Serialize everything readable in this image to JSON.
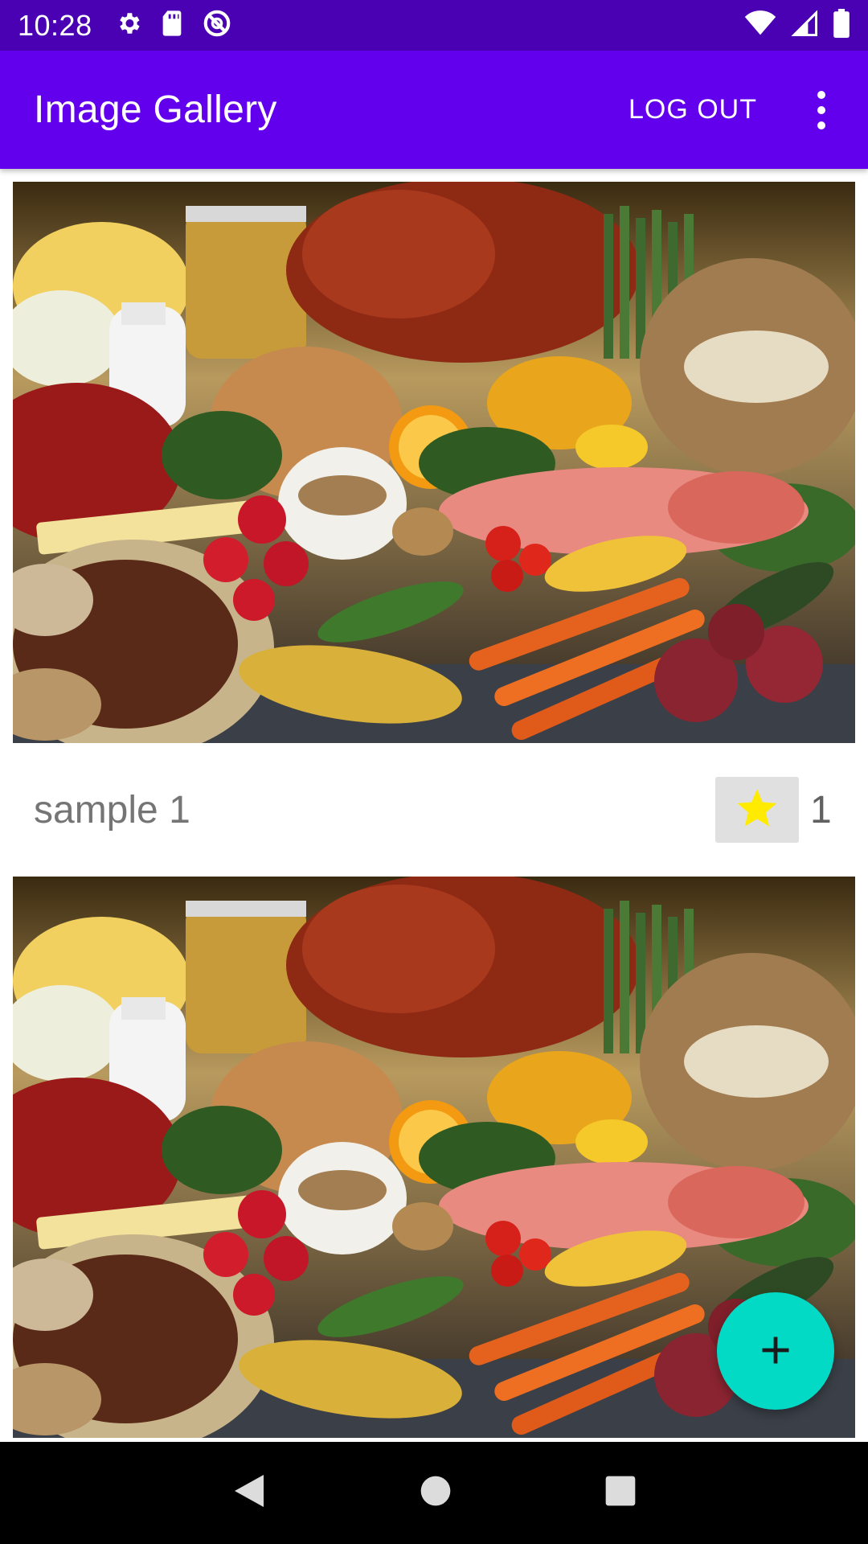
{
  "status_bar": {
    "time": "10:28",
    "left_icons": [
      "settings-icon",
      "sd-card-icon",
      "sync-icon"
    ],
    "right_icons": [
      "wifi-icon",
      "signal-icon",
      "battery-icon"
    ],
    "color": "#4a00b3"
  },
  "app_bar": {
    "title": "Image Gallery",
    "logout_label": "LOG OUT",
    "menu_icon": "more-vert-icon",
    "color": "#6200ee"
  },
  "gallery": {
    "items": [
      {
        "title": "sample 1",
        "favorite_count": "1",
        "favorite_icon": "star-icon",
        "star_color": "#ffeb00"
      },
      {
        "title": "",
        "favorite_count": "",
        "favorite_icon": "",
        "star_color": "#ffeb00"
      }
    ]
  },
  "fab": {
    "icon": "add-icon",
    "color": "#03dac5"
  },
  "nav_bar": {
    "icons": [
      "back-icon",
      "home-icon",
      "recents-icon"
    ]
  }
}
